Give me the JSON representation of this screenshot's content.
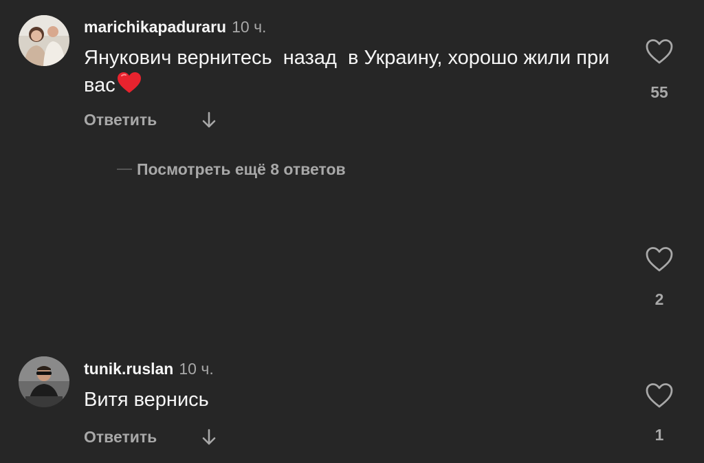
{
  "colors": {
    "background": "#262626",
    "primary_text": "#f5f5f5",
    "secondary_text": "#a8a8a8",
    "emoji_heart": "#e8232e"
  },
  "comments": [
    {
      "username": "marichikapaduraru",
      "time": "10 ч.",
      "text": "Янукович вернитесь  назад  в Украину, хорошо жили при вас",
      "emoji": "red-heart",
      "reply_label": "Ответить",
      "like_icon": "heart-outline-icon",
      "like_count": "55",
      "view_replies_label": "Посмотреть ещё 8 ответов"
    },
    {
      "like_icon": "heart-outline-icon",
      "like_count": "2"
    },
    {
      "username": "tunik.ruslan",
      "time": "10 ч.",
      "text": "Витя вернись",
      "reply_label": "Ответить",
      "like_icon": "heart-outline-icon",
      "like_count": "1"
    }
  ]
}
